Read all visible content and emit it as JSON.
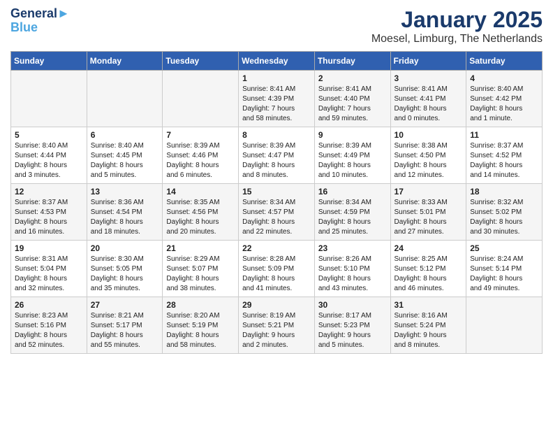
{
  "header": {
    "logo_line1": "General",
    "logo_line2": "Blue",
    "title": "January 2025",
    "subtitle": "Moesel, Limburg, The Netherlands"
  },
  "weekdays": [
    "Sunday",
    "Monday",
    "Tuesday",
    "Wednesday",
    "Thursday",
    "Friday",
    "Saturday"
  ],
  "weeks": [
    [
      {
        "day": "",
        "text": ""
      },
      {
        "day": "",
        "text": ""
      },
      {
        "day": "",
        "text": ""
      },
      {
        "day": "1",
        "text": "Sunrise: 8:41 AM\nSunset: 4:39 PM\nDaylight: 7 hours\nand 58 minutes."
      },
      {
        "day": "2",
        "text": "Sunrise: 8:41 AM\nSunset: 4:40 PM\nDaylight: 7 hours\nand 59 minutes."
      },
      {
        "day": "3",
        "text": "Sunrise: 8:41 AM\nSunset: 4:41 PM\nDaylight: 8 hours\nand 0 minutes."
      },
      {
        "day": "4",
        "text": "Sunrise: 8:40 AM\nSunset: 4:42 PM\nDaylight: 8 hours\nand 1 minute."
      }
    ],
    [
      {
        "day": "5",
        "text": "Sunrise: 8:40 AM\nSunset: 4:44 PM\nDaylight: 8 hours\nand 3 minutes."
      },
      {
        "day": "6",
        "text": "Sunrise: 8:40 AM\nSunset: 4:45 PM\nDaylight: 8 hours\nand 5 minutes."
      },
      {
        "day": "7",
        "text": "Sunrise: 8:39 AM\nSunset: 4:46 PM\nDaylight: 8 hours\nand 6 minutes."
      },
      {
        "day": "8",
        "text": "Sunrise: 8:39 AM\nSunset: 4:47 PM\nDaylight: 8 hours\nand 8 minutes."
      },
      {
        "day": "9",
        "text": "Sunrise: 8:39 AM\nSunset: 4:49 PM\nDaylight: 8 hours\nand 10 minutes."
      },
      {
        "day": "10",
        "text": "Sunrise: 8:38 AM\nSunset: 4:50 PM\nDaylight: 8 hours\nand 12 minutes."
      },
      {
        "day": "11",
        "text": "Sunrise: 8:37 AM\nSunset: 4:52 PM\nDaylight: 8 hours\nand 14 minutes."
      }
    ],
    [
      {
        "day": "12",
        "text": "Sunrise: 8:37 AM\nSunset: 4:53 PM\nDaylight: 8 hours\nand 16 minutes."
      },
      {
        "day": "13",
        "text": "Sunrise: 8:36 AM\nSunset: 4:54 PM\nDaylight: 8 hours\nand 18 minutes."
      },
      {
        "day": "14",
        "text": "Sunrise: 8:35 AM\nSunset: 4:56 PM\nDaylight: 8 hours\nand 20 minutes."
      },
      {
        "day": "15",
        "text": "Sunrise: 8:34 AM\nSunset: 4:57 PM\nDaylight: 8 hours\nand 22 minutes."
      },
      {
        "day": "16",
        "text": "Sunrise: 8:34 AM\nSunset: 4:59 PM\nDaylight: 8 hours\nand 25 minutes."
      },
      {
        "day": "17",
        "text": "Sunrise: 8:33 AM\nSunset: 5:01 PM\nDaylight: 8 hours\nand 27 minutes."
      },
      {
        "day": "18",
        "text": "Sunrise: 8:32 AM\nSunset: 5:02 PM\nDaylight: 8 hours\nand 30 minutes."
      }
    ],
    [
      {
        "day": "19",
        "text": "Sunrise: 8:31 AM\nSunset: 5:04 PM\nDaylight: 8 hours\nand 32 minutes."
      },
      {
        "day": "20",
        "text": "Sunrise: 8:30 AM\nSunset: 5:05 PM\nDaylight: 8 hours\nand 35 minutes."
      },
      {
        "day": "21",
        "text": "Sunrise: 8:29 AM\nSunset: 5:07 PM\nDaylight: 8 hours\nand 38 minutes."
      },
      {
        "day": "22",
        "text": "Sunrise: 8:28 AM\nSunset: 5:09 PM\nDaylight: 8 hours\nand 41 minutes."
      },
      {
        "day": "23",
        "text": "Sunrise: 8:26 AM\nSunset: 5:10 PM\nDaylight: 8 hours\nand 43 minutes."
      },
      {
        "day": "24",
        "text": "Sunrise: 8:25 AM\nSunset: 5:12 PM\nDaylight: 8 hours\nand 46 minutes."
      },
      {
        "day": "25",
        "text": "Sunrise: 8:24 AM\nSunset: 5:14 PM\nDaylight: 8 hours\nand 49 minutes."
      }
    ],
    [
      {
        "day": "26",
        "text": "Sunrise: 8:23 AM\nSunset: 5:16 PM\nDaylight: 8 hours\nand 52 minutes."
      },
      {
        "day": "27",
        "text": "Sunrise: 8:21 AM\nSunset: 5:17 PM\nDaylight: 8 hours\nand 55 minutes."
      },
      {
        "day": "28",
        "text": "Sunrise: 8:20 AM\nSunset: 5:19 PM\nDaylight: 8 hours\nand 58 minutes."
      },
      {
        "day": "29",
        "text": "Sunrise: 8:19 AM\nSunset: 5:21 PM\nDaylight: 9 hours\nand 2 minutes."
      },
      {
        "day": "30",
        "text": "Sunrise: 8:17 AM\nSunset: 5:23 PM\nDaylight: 9 hours\nand 5 minutes."
      },
      {
        "day": "31",
        "text": "Sunrise: 8:16 AM\nSunset: 5:24 PM\nDaylight: 9 hours\nand 8 minutes."
      },
      {
        "day": "",
        "text": ""
      }
    ]
  ]
}
